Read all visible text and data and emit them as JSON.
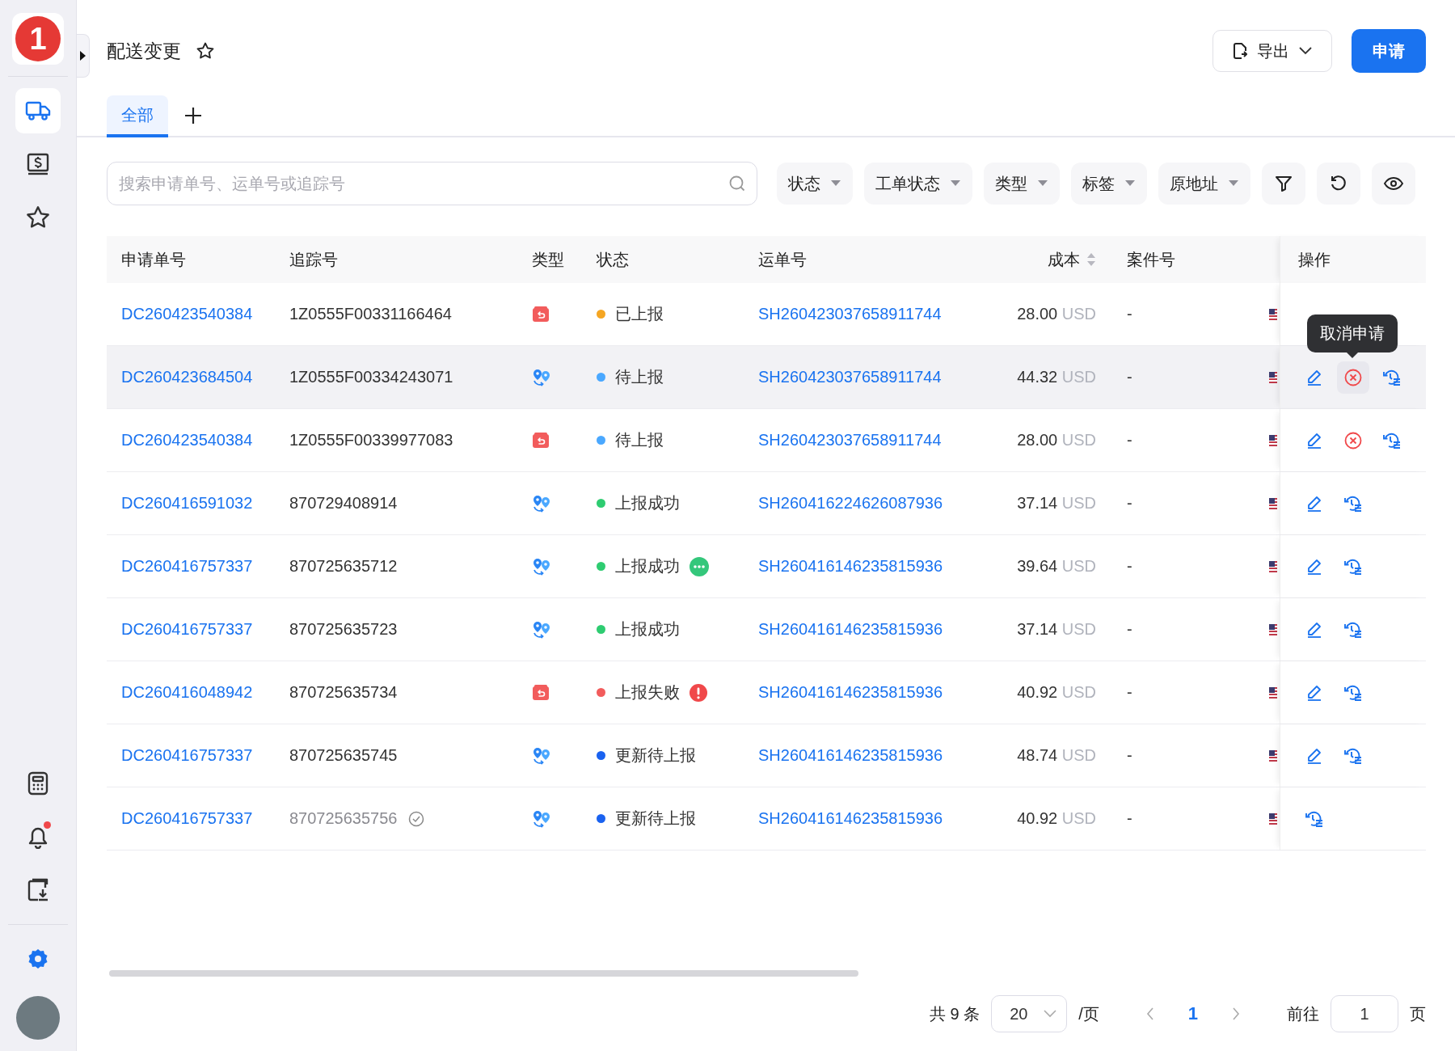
{
  "sidebar": {
    "logo": "1",
    "nav_items": [
      {
        "selected": true
      },
      {
        "selected": false
      },
      {
        "selected": false
      }
    ],
    "tools": [
      {
        "dot": false
      },
      {
        "dot": true
      },
      {
        "dot": false
      }
    ]
  },
  "header": {
    "title": "配送变更",
    "favorite": false,
    "export_label": "导出",
    "apply_label": "申请"
  },
  "tabs": [
    {
      "label": "全部",
      "selected": true
    }
  ],
  "search": {
    "placeholder": "搜索申请单号、运单号或追踪号"
  },
  "filters": [
    "状态",
    "工单状态",
    "类型",
    "标签",
    "原地址"
  ],
  "table": {
    "columns": [
      "申请单号",
      "追踪号",
      "类型",
      "状态",
      "运单号",
      "成本",
      "案件号",
      "操作"
    ],
    "rows": [
      {
        "request_no": "DC260423540384",
        "tracking_no": "1Z0555F00331166464",
        "verified": false,
        "kind": "return",
        "status": "已上报",
        "color": "#f5a623",
        "more": false,
        "error": false,
        "waybill": "SH260423037658911744",
        "cost": "28.00",
        "currency": "USD",
        "case_no": "-",
        "edit": false,
        "cancel": false,
        "history": false,
        "highlighted": false
      },
      {
        "request_no": "DC260423684504",
        "tracking_no": "1Z0555F00334243071",
        "verified": false,
        "kind": "reroute",
        "status": "待上报",
        "color": "#4aa8ff",
        "more": false,
        "error": false,
        "waybill": "SH260423037658911744",
        "cost": "44.32",
        "currency": "USD",
        "case_no": "-",
        "edit": true,
        "cancel": true,
        "history": true,
        "highlighted": true,
        "tooltip": "取消申请"
      },
      {
        "request_no": "DC260423540384",
        "tracking_no": "1Z0555F00339977083",
        "verified": false,
        "kind": "return",
        "status": "待上报",
        "color": "#4aa8ff",
        "more": false,
        "error": false,
        "waybill": "SH260423037658911744",
        "cost": "28.00",
        "currency": "USD",
        "case_no": "-",
        "edit": true,
        "cancel": true,
        "history": true,
        "highlighted": false
      },
      {
        "request_no": "DC260416591032",
        "tracking_no": "870729408914",
        "verified": false,
        "kind": "reroute",
        "status": "上报成功",
        "color": "#2ecc71",
        "more": false,
        "error": false,
        "waybill": "SH260416224626087936",
        "cost": "37.14",
        "currency": "USD",
        "case_no": "-",
        "edit": true,
        "cancel": false,
        "history": true,
        "highlighted": false
      },
      {
        "request_no": "DC260416757337",
        "tracking_no": "870725635712",
        "verified": false,
        "kind": "reroute",
        "status": "上报成功",
        "color": "#2ecc71",
        "more": true,
        "error": false,
        "waybill": "SH260416146235815936",
        "cost": "39.64",
        "currency": "USD",
        "case_no": "-",
        "edit": true,
        "cancel": false,
        "history": true,
        "highlighted": false
      },
      {
        "request_no": "DC260416757337",
        "tracking_no": "870725635723",
        "verified": false,
        "kind": "reroute",
        "status": "上报成功",
        "color": "#2ecc71",
        "more": false,
        "error": false,
        "waybill": "SH260416146235815936",
        "cost": "37.14",
        "currency": "USD",
        "case_no": "-",
        "edit": true,
        "cancel": false,
        "history": true,
        "highlighted": false
      },
      {
        "request_no": "DC260416048942",
        "tracking_no": "870725635734",
        "verified": false,
        "kind": "return",
        "status": "上报失败",
        "color": "#f25c5c",
        "more": false,
        "error": true,
        "waybill": "SH260416146235815936",
        "cost": "40.92",
        "currency": "USD",
        "case_no": "-",
        "edit": true,
        "cancel": false,
        "history": true,
        "highlighted": false
      },
      {
        "request_no": "DC260416757337",
        "tracking_no": "870725635745",
        "verified": false,
        "kind": "reroute",
        "status": "更新待上报",
        "color": "#1a62f0",
        "more": false,
        "error": false,
        "waybill": "SH260416146235815936",
        "cost": "48.74",
        "currency": "USD",
        "case_no": "-",
        "edit": true,
        "cancel": false,
        "history": true,
        "highlighted": false
      },
      {
        "request_no": "DC260416757337",
        "tracking_no": "870725635756",
        "verified": true,
        "kind": "reroute",
        "status": "更新待上报",
        "color": "#1a62f0",
        "more": false,
        "error": false,
        "waybill": "SH260416146235815936",
        "cost": "40.92",
        "currency": "USD",
        "case_no": "-",
        "edit": false,
        "cancel": false,
        "history": true,
        "highlighted": false
      }
    ]
  },
  "pagination": {
    "total": "共 9 条",
    "page_size": "20",
    "per_page": "/页",
    "current": "1",
    "goto_label": "前往",
    "goto_value": "1",
    "page_unit": "页"
  }
}
